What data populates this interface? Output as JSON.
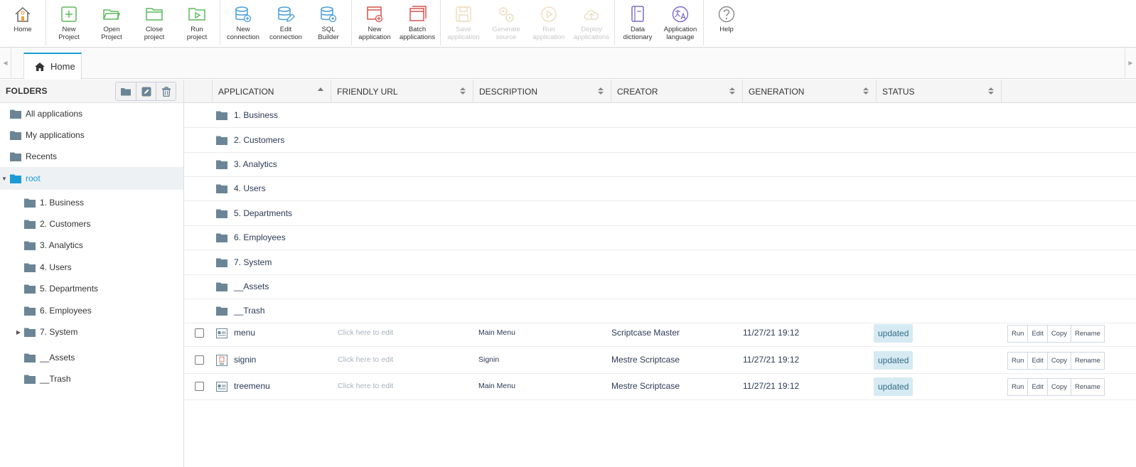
{
  "toolbar": {
    "home": "Home",
    "new_project": "New\nProject",
    "open_project": "Open\nProject",
    "close_project": "Close\nproject",
    "run_project": "Run\nproject",
    "new_connection": "New\nconnection",
    "edit_connection": "Edit\nconnection",
    "sql_builder": "SQL\nBuilder",
    "new_application": "New\napplication",
    "batch_applications": "Batch\napplications",
    "save_application": "Save\napplication",
    "generate_source": "Generate\nsource",
    "run_application": "Run\napplication",
    "deploy_applications": "Deploy\napplications",
    "data_dictionary": "Data\ndictionary",
    "application_language": "Application\nlanguage",
    "help": "Help"
  },
  "tabs": {
    "home": "Home"
  },
  "sidebar": {
    "title": "FOLDERS",
    "top_items": [
      "All applications",
      "My applications",
      "Recents"
    ],
    "root": "root",
    "children": [
      "1. Business",
      "2. Customers",
      "3. Analytics",
      "4. Users",
      "5. Departments",
      "6. Employees",
      "7. System",
      "__Assets",
      "__Trash"
    ]
  },
  "grid": {
    "columns": {
      "application": "APPLICATION",
      "friendly_url": "FRIENDLY URL",
      "description": "DESCRIPTION",
      "creator": "CREATOR",
      "generation": "GENERATION",
      "status": "STATUS"
    },
    "folders": [
      "1. Business",
      "2. Customers",
      "3. Analytics",
      "4. Users",
      "5. Departments",
      "6. Employees",
      "7. System",
      "__Assets",
      "__Trash"
    ],
    "apps": [
      {
        "name": "menu",
        "url": "Click here to edit",
        "description": "Main Menu",
        "creator": "Scriptcase Master",
        "generation": "11/27/21 19:12",
        "status": "updated"
      },
      {
        "name": "signin",
        "url": "Click here to edit",
        "description": "Signin",
        "creator": "Mestre Scriptcase",
        "generation": "11/27/21 19:12",
        "status": "updated"
      },
      {
        "name": "treemenu",
        "url": "Click here to edit",
        "description": "Main Menu",
        "creator": "Mestre Scriptcase",
        "generation": "11/27/21 19:12",
        "status": "updated"
      }
    ],
    "actions": {
      "run": "Run",
      "edit": "Edit",
      "copy": "Copy",
      "rename": "Rename"
    }
  },
  "colors": {
    "accent": "#1a9bd7",
    "folder": "#6b8596",
    "green": "#5cb85c",
    "blue": "#4a9fd8",
    "red": "#d9534f",
    "purple": "#7b68c8"
  }
}
